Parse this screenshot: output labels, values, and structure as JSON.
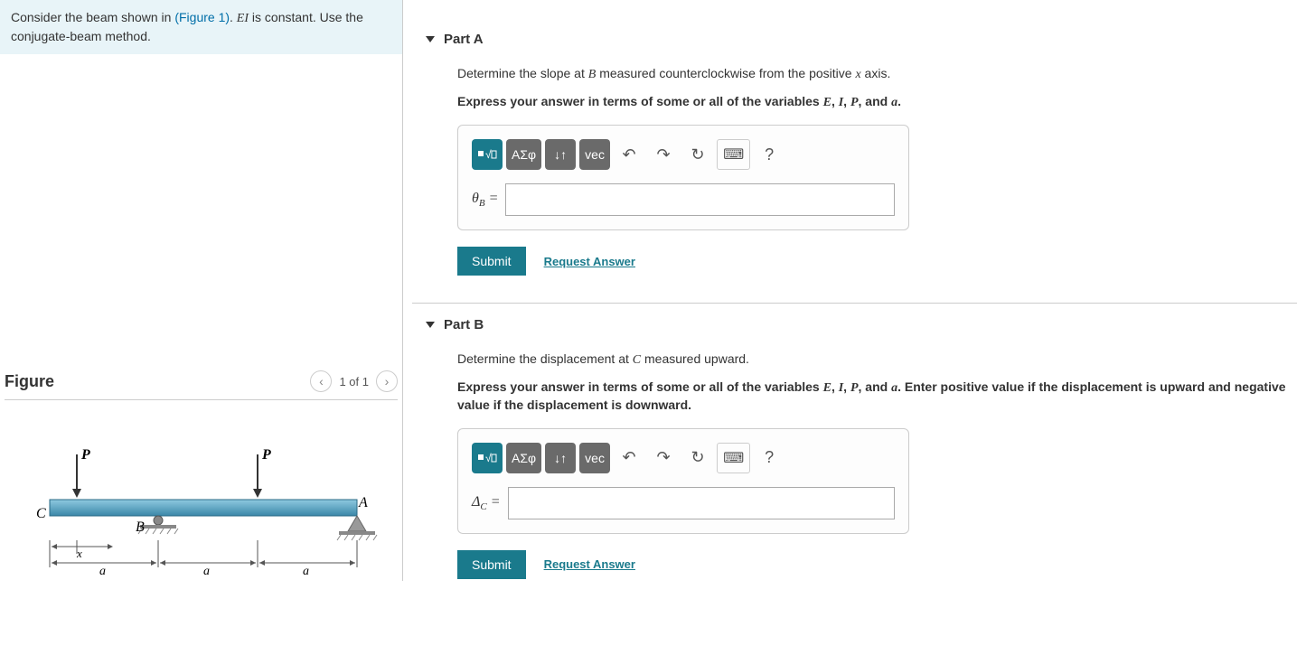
{
  "problem": {
    "text_before_link": "Consider the beam shown in ",
    "link_text": "(Figure 1)",
    "text_after_link": ". ",
    "var1": "EI",
    "text_after_var": " is constant. Use the conjugate-beam method."
  },
  "figure": {
    "title": "Figure",
    "pager": "1 of 1",
    "labels": {
      "P1": "P",
      "P2": "P",
      "A": "A",
      "B": "B",
      "C": "C",
      "x": "x",
      "a1": "a",
      "a2": "a",
      "a3": "a"
    }
  },
  "partA": {
    "title": "Part A",
    "question_before": "Determine the slope at ",
    "question_var": "B",
    "question_after": " measured counterclockwise from the positive ",
    "question_var2": "x",
    "question_after2": " axis.",
    "instruction_before": "Express your answer in terms of some or all of the variables ",
    "vE": "E",
    "vI": "I",
    "vP": "P",
    "va": "a",
    "instruction_after": ".",
    "answer_label_sym": "θ",
    "answer_label_sub": "B",
    "answer_eq": " =",
    "submit": "Submit",
    "request": "Request Answer"
  },
  "partB": {
    "title": "Part B",
    "question_before": "Determine the displacement at ",
    "question_var": "C",
    "question_after": " measured upward.",
    "instruction_before": "Express your answer in terms of some or all of the variables ",
    "vE": "E",
    "vI": "I",
    "vP": "P",
    "va": "a",
    "instruction_mid": ". Enter positive value if the displacement is upward and negative value if the displacement is downward.",
    "answer_label_sym": "Δ",
    "answer_label_sub": "C",
    "answer_eq": " =",
    "submit": "Submit",
    "request": "Request Answer"
  },
  "toolbar": {
    "templates": "■√□",
    "greek": "ΑΣφ",
    "subsup": "↓↑",
    "vec": "vec",
    "undo": "↶",
    "redo": "↷",
    "reset": "↻",
    "keyboard": "⌨",
    "help": "?"
  }
}
